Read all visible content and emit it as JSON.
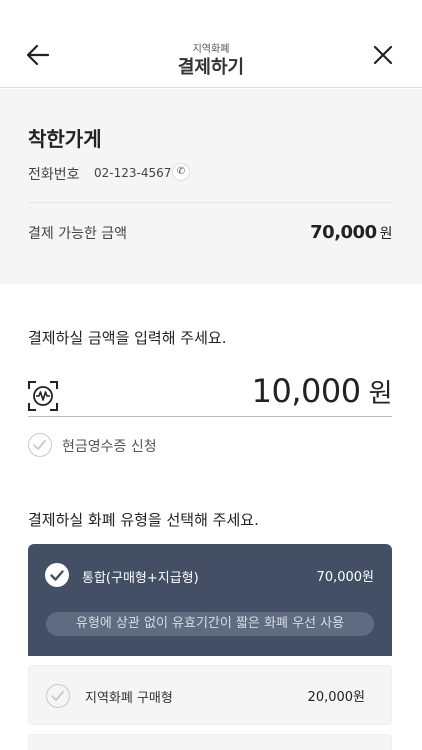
{
  "header": {
    "subtitle": "지역화폐",
    "title": "결제하기"
  },
  "store": {
    "name": "착한가게",
    "phone_label": "전화번호",
    "phone_number": "02-123-4567",
    "available_label": "결제 가능한 금액",
    "available_amount": "70,000",
    "currency_unit": "원"
  },
  "amount_entry": {
    "prompt": "결제하실 금액을 입력해 주세요.",
    "value": "10,000",
    "unit": "원",
    "receipt_label": "현금영수증 신청"
  },
  "currency_type": {
    "prompt": "결제하실 화폐 유형을 선택해 주세요.",
    "options": [
      {
        "label": "통합(구매형+지급형)",
        "amount": "70,000원",
        "note": "유형에 상관 없이 유효기간이 짧은 화폐 우선 사용",
        "selected": true
      },
      {
        "label": "지역화폐 구매형",
        "amount": "20,000원",
        "selected": false
      }
    ]
  },
  "colors": {
    "selected_option_bg": "#434f64",
    "option_note_bg": "#5e6b80",
    "section_bg": "#f5f5f5"
  },
  "icons": {
    "back": "back-arrow-icon",
    "close": "close-icon",
    "phone": "phone-icon",
    "scan": "scan-icon",
    "check": "check-icon"
  }
}
